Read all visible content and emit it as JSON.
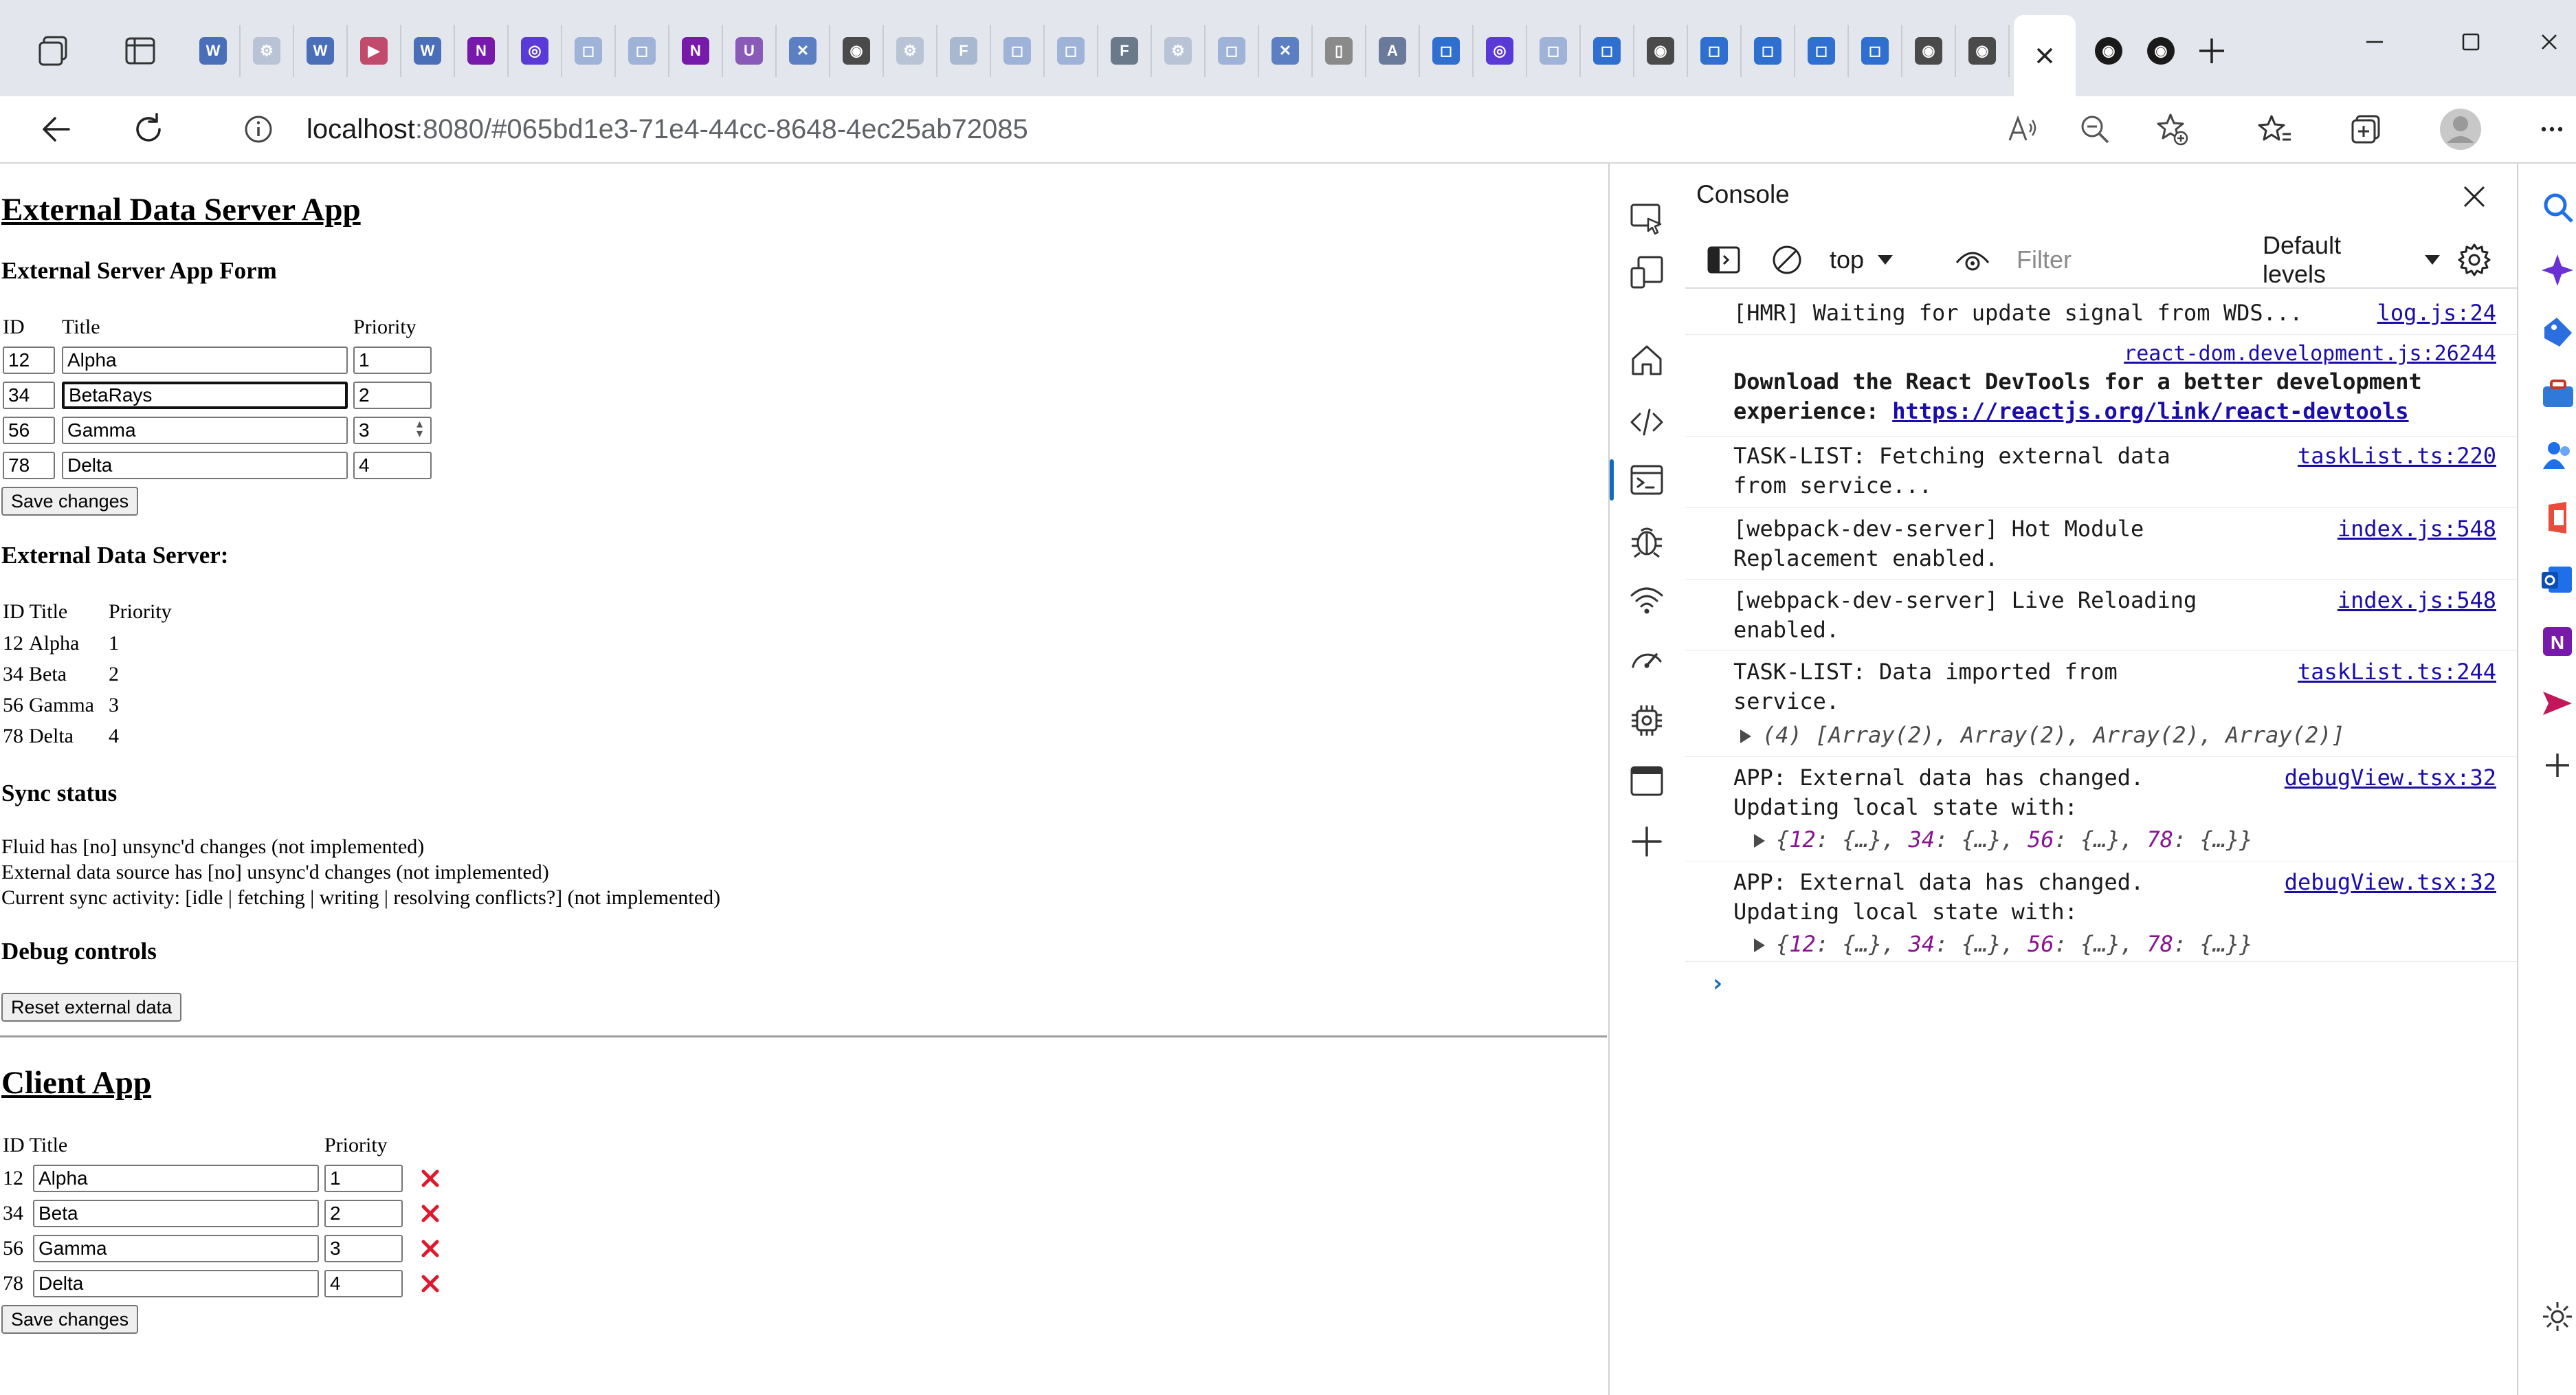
{
  "browser": {
    "tabs": [
      {
        "name": "word-doc",
        "color": "#4a6fb8",
        "glyph": "W"
      },
      {
        "name": "settings",
        "color": "#b8c4d6",
        "glyph": "⚙"
      },
      {
        "name": "word-doc",
        "color": "#4a6fb8",
        "glyph": "W"
      },
      {
        "name": "video",
        "color": "#c24a6a",
        "glyph": "▶"
      },
      {
        "name": "word-doc",
        "color": "#4a6fb8",
        "glyph": "W"
      },
      {
        "name": "onenote",
        "color": "#7719aa",
        "glyph": "N"
      },
      {
        "name": "loop",
        "color": "#5a3ad6",
        "glyph": "◎"
      },
      {
        "name": "page",
        "color": "#9fb2d8",
        "glyph": "◻"
      },
      {
        "name": "page",
        "color": "#9fb2d8",
        "glyph": "◻"
      },
      {
        "name": "onenote",
        "color": "#7719aa",
        "glyph": "N"
      },
      {
        "name": "app",
        "color": "#8a5ab8",
        "glyph": "U"
      },
      {
        "name": "tools",
        "color": "#5c7fc4",
        "glyph": "✕"
      },
      {
        "name": "github",
        "color": "#4a4a4a",
        "glyph": "◉"
      },
      {
        "name": "settings",
        "color": "#b8c4d6",
        "glyph": "⚙"
      },
      {
        "name": "fluid",
        "color": "#a8b8d0",
        "glyph": "F"
      },
      {
        "name": "page",
        "color": "#9fb2d8",
        "glyph": "◻"
      },
      {
        "name": "page",
        "color": "#9fb2d8",
        "glyph": "◻"
      },
      {
        "name": "app",
        "color": "#6a7a8a",
        "glyph": "F"
      },
      {
        "name": "settings",
        "color": "#b8c4d6",
        "glyph": "⚙"
      },
      {
        "name": "page",
        "color": "#9fb2d8",
        "glyph": "◻"
      },
      {
        "name": "tools",
        "color": "#5c7fc4",
        "glyph": "✕"
      },
      {
        "name": "document",
        "color": "#8a8a8a",
        "glyph": "▯"
      },
      {
        "name": "app",
        "color": "#6a7a9a",
        "glyph": "A"
      },
      {
        "name": "page",
        "color": "#2f6fd0",
        "glyph": "◻"
      },
      {
        "name": "loop",
        "color": "#5a3ad6",
        "glyph": "◎"
      },
      {
        "name": "page",
        "color": "#9fb2d8",
        "glyph": "◻"
      },
      {
        "name": "page",
        "color": "#2f6fd0",
        "glyph": "◻"
      },
      {
        "name": "github",
        "color": "#4a4a4a",
        "glyph": "◉"
      },
      {
        "name": "page",
        "color": "#2f6fd0",
        "glyph": "◻"
      },
      {
        "name": "page",
        "color": "#2f6fd0",
        "glyph": "◻"
      },
      {
        "name": "page",
        "color": "#2f6fd0",
        "glyph": "◻"
      },
      {
        "name": "page",
        "color": "#2f6fd0",
        "glyph": "◻"
      },
      {
        "name": "github",
        "color": "#4a4a4a",
        "glyph": "◉"
      },
      {
        "name": "github",
        "color": "#4a4a4a",
        "glyph": "◉"
      },
      {
        "name": "github",
        "color": "#4a4a4a",
        "glyph": "◉"
      }
    ],
    "after_tabs": [
      {
        "name": "github",
        "color": "#1a1a1a",
        "glyph": "◉"
      },
      {
        "name": "github",
        "color": "#1a1a1a",
        "glyph": "◉"
      }
    ],
    "url_host": "localhost",
    "url_rest": ":8080/#065bd1e3-71e4-44cc-8648-4ec25ab72085"
  },
  "page": {
    "server_app_title": "External Data Server App",
    "server_form_title": "External Server App Form",
    "form_headers": {
      "id": "ID",
      "title": "Title",
      "priority": "Priority"
    },
    "form_rows": [
      {
        "id": "12",
        "title": "Alpha",
        "priority": "1"
      },
      {
        "id": "34",
        "title": "BetaRays",
        "priority": "2"
      },
      {
        "id": "56",
        "title": "Gamma",
        "priority": "3"
      },
      {
        "id": "78",
        "title": "Delta",
        "priority": "4"
      }
    ],
    "save_label": "Save changes",
    "data_server_title": "External Data Server:",
    "server_headers": {
      "id": "ID",
      "title": "Title",
      "priority": "Priority"
    },
    "server_rows": [
      {
        "id": "12",
        "title": "Alpha",
        "priority": "1"
      },
      {
        "id": "34",
        "title": "Beta",
        "priority": "2"
      },
      {
        "id": "56",
        "title": "Gamma",
        "priority": "3"
      },
      {
        "id": "78",
        "title": "Delta",
        "priority": "4"
      }
    ],
    "sync_title": "Sync status",
    "sync_lines": [
      "Fluid has [no] unsync'd changes (not implemented)",
      "External data source has [no] unsync'd changes (not implemented)",
      "Current sync activity: [idle | fetching | writing | resolving conflicts?] (not implemented)"
    ],
    "debug_title": "Debug controls",
    "reset_label": "Reset external data",
    "client_app_title": "Client App",
    "client_headers": {
      "id": "ID",
      "title": "Title",
      "priority": "Priority"
    },
    "client_rows": [
      {
        "id": "12",
        "title": "Alpha",
        "priority": "1"
      },
      {
        "id": "34",
        "title": "Beta",
        "priority": "2"
      },
      {
        "id": "56",
        "title": "Gamma",
        "priority": "3"
      },
      {
        "id": "78",
        "title": "Delta",
        "priority": "4"
      }
    ],
    "client_save_label": "Save changes"
  },
  "devtools": {
    "console_title": "Console",
    "context": "top",
    "filter_placeholder": "Filter",
    "levels": "Default levels",
    "messages": [
      {
        "lines": [
          "[HMR] Waiting for update signal from WDS..."
        ],
        "source": "log.js:24"
      },
      {
        "source_solo": "react-dom.development.js:26244",
        "bold_lines": [
          "Download the React DevTools for a better development"
        ],
        "bold_prefix": "experience: ",
        "link": "https://reactjs.org/link/react-devtools"
      },
      {
        "lines": [
          "TASK-LIST: Fetching external data",
          "from service..."
        ],
        "source": "taskList.ts:220"
      },
      {
        "lines": [
          "[webpack-dev-server] Hot Module",
          "Replacement enabled."
        ],
        "source": "index.js:548"
      },
      {
        "lines": [
          "[webpack-dev-server] Live Reloading",
          "enabled."
        ],
        "source": "index.js:548"
      },
      {
        "lines": [
          "TASK-LIST: Data imported from",
          "service."
        ],
        "source": "taskList.ts:244",
        "object": "(4) [Array(2), Array(2), Array(2), Array(2)]"
      },
      {
        "lines": [
          "APP: External data has changed.",
          "Updating local state with:"
        ],
        "source": "debugView.tsx:32",
        "object_keys": [
          "12",
          "34",
          "56",
          "78"
        ]
      },
      {
        "lines": [
          "APP: External data has changed.",
          "Updating local state with:"
        ],
        "source": "debugView.tsx:32",
        "object_keys": [
          "12",
          "34",
          "56",
          "78"
        ]
      }
    ],
    "prompt": "›"
  },
  "colors": {
    "accent": "#0f6cbd",
    "link": "#1a0dab",
    "delete": "#e0182d",
    "object_key": "#881391"
  }
}
